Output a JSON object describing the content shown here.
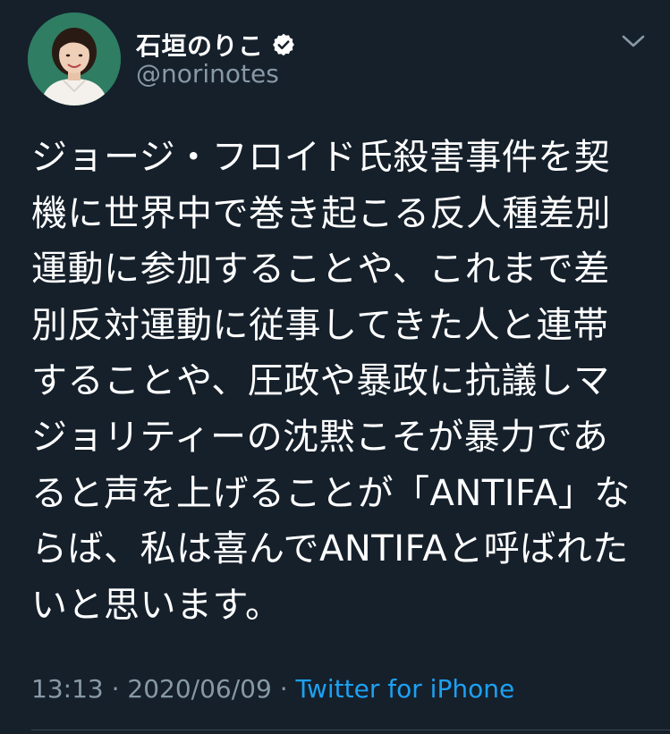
{
  "tweet": {
    "author": {
      "display_name": "石垣のりこ",
      "handle": "@norinotes",
      "verified": true
    },
    "text": "ジョージ・フロイド氏殺害事件を契\n機に世界中で巻き起こる反人種差別\n運動に参加することや、これまで差\n別反対運動に従事してきた人と連帯\nすることや、圧政や暴政に抗議しマ\nジョリティーの沈黙こそが暴力であ\nると声を上げることが「ANTIFA」な\nらば、私は喜んでANTIFAと呼ばれた\nいと思います。",
    "time": "13:13",
    "separator": "·",
    "date": "2020/06/09",
    "source": "Twitter for iPhone"
  },
  "icons": {
    "verified": "verified-badge-icon",
    "menu": "chevron-down-icon"
  },
  "colors": {
    "background": "#15202b",
    "text": "#ffffff",
    "secondary_text": "#8899a6",
    "link": "#1da1f2",
    "avatar_bg": "#2f7d62"
  }
}
